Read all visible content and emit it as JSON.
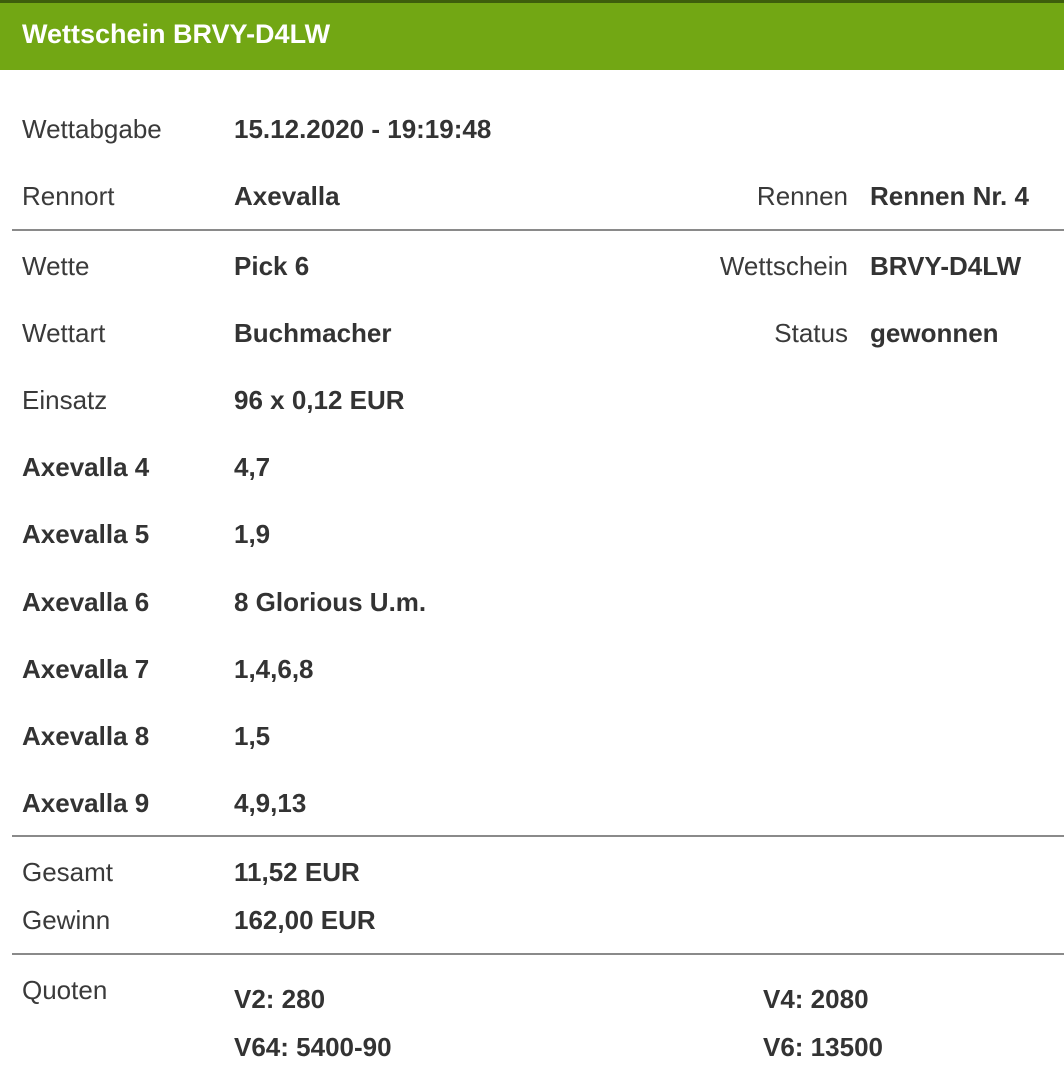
{
  "header": {
    "title": "Wettschein BRVY-D4LW"
  },
  "info": {
    "wettabgabe": {
      "label": "Wettabgabe",
      "value": "15.12.2020 - 19:19:48"
    },
    "rennort": {
      "label": "Rennort",
      "value": "Axevalla"
    },
    "rennen": {
      "label": "Rennen",
      "value": "Rennen Nr. 4"
    },
    "wette": {
      "label": "Wette",
      "value": "Pick 6"
    },
    "wettschein": {
      "label": "Wettschein",
      "value": "BRVY-D4LW"
    },
    "wettart": {
      "label": "Wettart",
      "value": "Buchmacher"
    },
    "status": {
      "label": "Status",
      "value": "gewonnen"
    },
    "einsatz": {
      "label": "Einsatz",
      "value": "96 x 0,12 EUR"
    }
  },
  "legs": [
    {
      "race": "Axevalla 4",
      "selection": "4,7"
    },
    {
      "race": "Axevalla 5",
      "selection": "1,9"
    },
    {
      "race": "Axevalla 6",
      "selection": "8 Glorious U.m."
    },
    {
      "race": "Axevalla 7",
      "selection": "1,4,6,8"
    },
    {
      "race": "Axevalla 8",
      "selection": "1,5"
    },
    {
      "race": "Axevalla 9",
      "selection": "4,9,13"
    }
  ],
  "totals": {
    "gesamt": {
      "label": "Gesamt",
      "value": "11,52 EUR"
    },
    "gewinn": {
      "label": "Gewinn",
      "value": "162,00 EUR"
    }
  },
  "quoten": {
    "label": "Quoten",
    "items": [
      "V2: 280",
      "V4: 2080",
      "V64: 5400-90",
      "V6: 13500"
    ]
  },
  "colors": {
    "header_bg": "#72a714",
    "header_border": "#3d5e0c",
    "text": "#333333",
    "divider": "#8a8a8a"
  }
}
